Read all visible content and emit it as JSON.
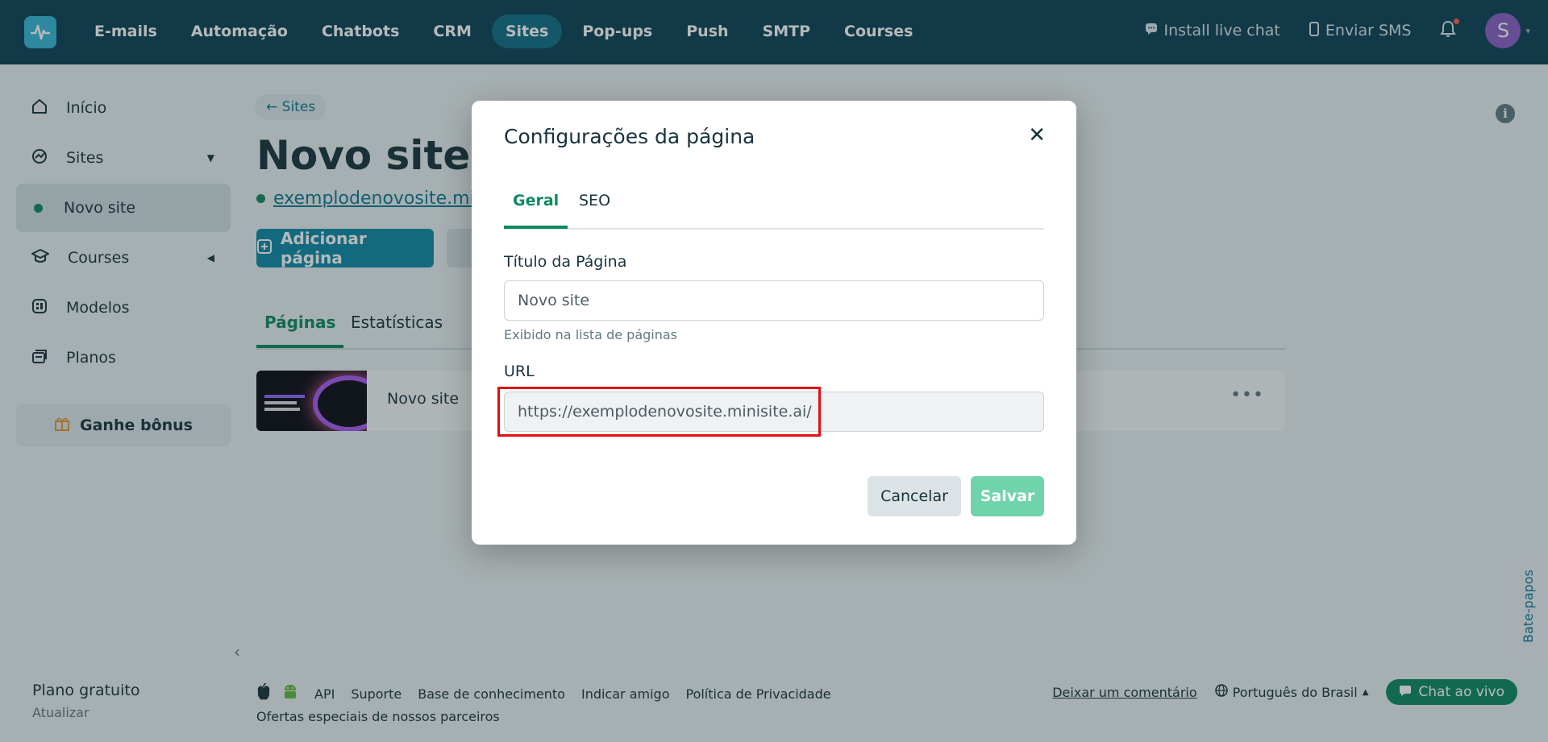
{
  "nav": {
    "items": [
      {
        "label": "E-mails",
        "active": false
      },
      {
        "label": "Automação",
        "active": false
      },
      {
        "label": "Chatbots",
        "active": false
      },
      {
        "label": "CRM",
        "active": false
      },
      {
        "label": "Sites",
        "active": true
      },
      {
        "label": "Pop-ups",
        "active": false
      },
      {
        "label": "Push",
        "active": false
      },
      {
        "label": "SMTP",
        "active": false
      },
      {
        "label": "Courses",
        "active": false
      }
    ],
    "install_chat": "Install live chat",
    "send_sms": "Enviar SMS",
    "avatar_letter": "S"
  },
  "sidebar": {
    "items": [
      {
        "label": "Início",
        "icon": "home-icon"
      },
      {
        "label": "Sites",
        "icon": "sites-icon"
      },
      {
        "label": "Novo site",
        "icon": "status-dot"
      },
      {
        "label": "Courses",
        "icon": "graduation-cap-icon"
      },
      {
        "label": "Modelos",
        "icon": "templates-icon"
      },
      {
        "label": "Planos",
        "icon": "plans-icon"
      }
    ],
    "bonus": "Ganhe bônus",
    "plan": "Plano gratuito",
    "plan_action": "Atualizar"
  },
  "main": {
    "back": "← Sites",
    "title": "Novo site",
    "site_url": "exemplodenovosite.minisite.ai",
    "add_page": "Adicionar página",
    "tabs": [
      "Páginas",
      "Estatísticas"
    ],
    "page_row": {
      "name": "Novo site"
    }
  },
  "footer": {
    "links": [
      "API",
      "Suporte",
      "Base de conhecimento",
      "Indicar amigo",
      "Política de Privacidade"
    ],
    "partners": "Ofertas especiais de nossos parceiros",
    "comment": "Deixar um comentário",
    "language": "Português do Brasil",
    "chat": "Chat ao vivo",
    "side_tab": "Bate-papos"
  },
  "modal": {
    "title": "Configurações da página",
    "tabs": [
      "Geral",
      "SEO"
    ],
    "page_title_label": "Título da Página",
    "page_title_value": "Novo site",
    "page_title_hint": "Exibido na lista de páginas",
    "url_label": "URL",
    "url_value": "https://exemplodenovosite.minisite.ai/",
    "cancel": "Cancelar",
    "save": "Salvar"
  },
  "colors": {
    "topbar": "#0b4155",
    "accent": "#0c8a5f",
    "primary_button": "#0e8aa8",
    "highlight": "#e01010"
  }
}
